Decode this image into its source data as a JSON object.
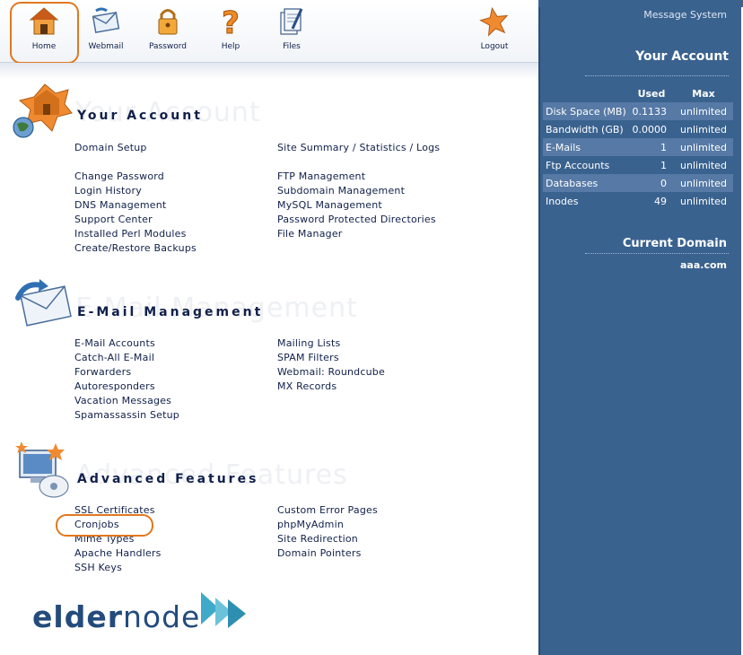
{
  "toolbar": {
    "home": "Home",
    "webmail": "Webmail",
    "password": "Password",
    "help": "Help",
    "files": "Files",
    "logout": "Logout"
  },
  "sidebar": {
    "message_system": "Message System",
    "account_title": "Your Account",
    "col_used": "Used",
    "col_max": "Max",
    "stats": [
      {
        "label": "Disk Space (MB)",
        "used": "0.1133",
        "max": "unlimited"
      },
      {
        "label": "Bandwidth (GB)",
        "used": "0.0000",
        "max": "unlimited"
      },
      {
        "label": "E-Mails",
        "used": "1",
        "max": "unlimited"
      },
      {
        "label": "Ftp Accounts",
        "used": "1",
        "max": "unlimited"
      },
      {
        "label": "Databases",
        "used": "0",
        "max": "unlimited"
      },
      {
        "label": "Inodes",
        "used": "49",
        "max": "unlimited"
      }
    ],
    "domain_title": "Current Domain",
    "domain_value": "aaa.com"
  },
  "sections": {
    "account": {
      "ghost": "Your Account",
      "title": "Your Account",
      "left": [
        "Domain Setup",
        "",
        "Change Password",
        "Login History",
        "DNS Management",
        "Support Center",
        "Installed Perl Modules",
        "Create/Restore Backups"
      ],
      "right": [
        "Site Summary / Statistics / Logs",
        "",
        "FTP Management",
        "Subdomain Management",
        "MySQL Management",
        "Password Protected Directories",
        "File Manager"
      ]
    },
    "email": {
      "ghost": "E-Mail Management",
      "title": "E-Mail Management",
      "left": [
        "E-Mail Accounts",
        "Catch-All E-Mail",
        "Forwarders",
        "Autoresponders",
        "Vacation Messages",
        "Spamassassin Setup"
      ],
      "right": [
        "Mailing Lists",
        "SPAM Filters",
        "Webmail: Roundcube",
        "MX Records"
      ]
    },
    "advanced": {
      "ghost": "Advanced Features",
      "title": "Advanced Features",
      "left": [
        "SSL Certificates",
        "Cronjobs",
        "Mime Types",
        "Apache Handlers",
        "SSH Keys"
      ],
      "right": [
        "Custom Error Pages",
        "phpMyAdmin",
        "Site Redirection",
        "Domain Pointers"
      ]
    }
  },
  "logo": {
    "bold": "elder",
    "thin": "node"
  },
  "colors": {
    "sidebar": "#3a628f",
    "highlight": "#e0781f",
    "text": "#10204a"
  }
}
